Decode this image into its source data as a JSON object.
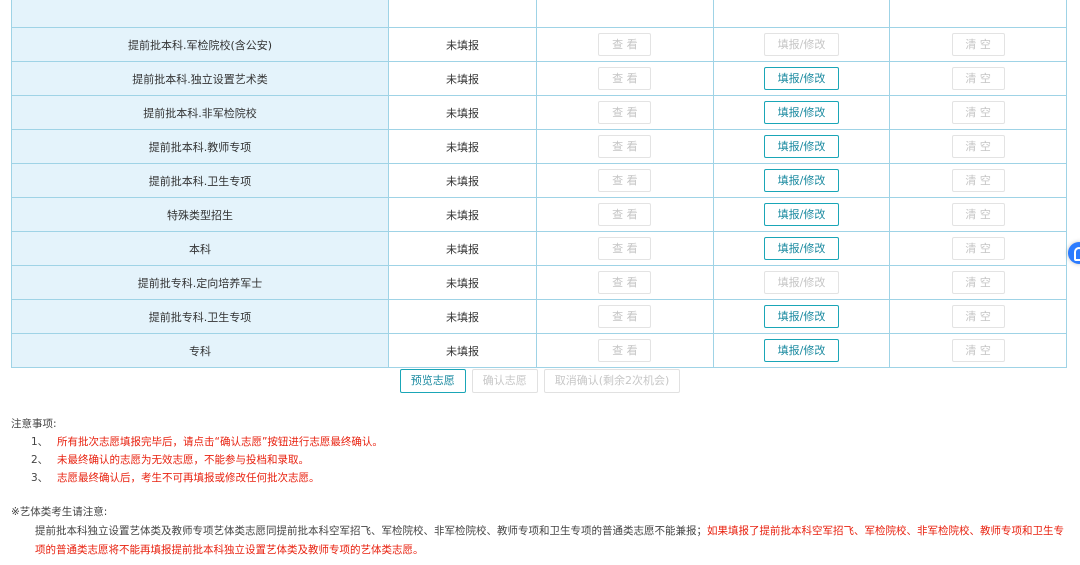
{
  "table": {
    "rows": [
      {
        "name": "",
        "status": "",
        "view": "",
        "fill": "",
        "clear": "",
        "fill_active": false
      },
      {
        "name": "提前批本科.军检院校(含公安)",
        "status": "未填报",
        "view": "查 看",
        "fill": "填报/修改",
        "clear": "清 空",
        "fill_active": false
      },
      {
        "name": "提前批本科.独立设置艺术类",
        "status": "未填报",
        "view": "查 看",
        "fill": "填报/修改",
        "clear": "清 空",
        "fill_active": true
      },
      {
        "name": "提前批本科.非军检院校",
        "status": "未填报",
        "view": "查 看",
        "fill": "填报/修改",
        "clear": "清 空",
        "fill_active": true
      },
      {
        "name": "提前批本科.教师专项",
        "status": "未填报",
        "view": "查 看",
        "fill": "填报/修改",
        "clear": "清 空",
        "fill_active": true
      },
      {
        "name": "提前批本科.卫生专项",
        "status": "未填报",
        "view": "查 看",
        "fill": "填报/修改",
        "clear": "清 空",
        "fill_active": true
      },
      {
        "name": "特殊类型招生",
        "status": "未填报",
        "view": "查 看",
        "fill": "填报/修改",
        "clear": "清 空",
        "fill_active": true
      },
      {
        "name": "本科",
        "status": "未填报",
        "view": "查 看",
        "fill": "填报/修改",
        "clear": "清 空",
        "fill_active": true
      },
      {
        "name": "提前批专科.定向培养军士",
        "status": "未填报",
        "view": "查 看",
        "fill": "填报/修改",
        "clear": "清 空",
        "fill_active": false
      },
      {
        "name": "提前批专科.卫生专项",
        "status": "未填报",
        "view": "查 看",
        "fill": "填报/修改",
        "clear": "清 空",
        "fill_active": true
      },
      {
        "name": "专科",
        "status": "未填报",
        "view": "查 看",
        "fill": "填报/修改",
        "clear": "清 空",
        "fill_active": true
      }
    ]
  },
  "actions": {
    "preview": "预览志愿",
    "confirm": "确认志愿",
    "cancel": "取消确认(剩余2次机会)"
  },
  "notes": {
    "title": "注意事项:",
    "items": [
      {
        "num": "1、",
        "text": "所有批次志愿填报完毕后，请点击“确认志愿”按钮进行志愿最终确认。"
      },
      {
        "num": "2、",
        "text": "未最终确认的志愿为无效志愿，不能参与投档和录取。"
      },
      {
        "num": "3、",
        "text": "志愿最终确认后，考生不可再填报或修改任何批次志愿。"
      }
    ]
  },
  "art_notice": {
    "title": "※艺体类考生请注意:",
    "black_text": "提前批本科独立设置艺体类及教师专项艺体类志愿同提前批本科空军招飞、军检院校、非军检院校、教师专项和卫生专项的普通类志愿不能兼报；",
    "red_text": "如果填报了提前批本科空军招飞、军检院校、非军检院校、教师专项和卫生专项的普通类志愿将不能再填报提前批本科独立设置艺体类及教师专项的艺体类志愿。"
  },
  "colors": {
    "accent": "#1aa6b7",
    "name_cell_bg": "#e4f3fb",
    "border": "#9fd3e6",
    "warning_red": "#e8210f"
  },
  "floating_widget": {
    "icon": "assistant-icon"
  }
}
